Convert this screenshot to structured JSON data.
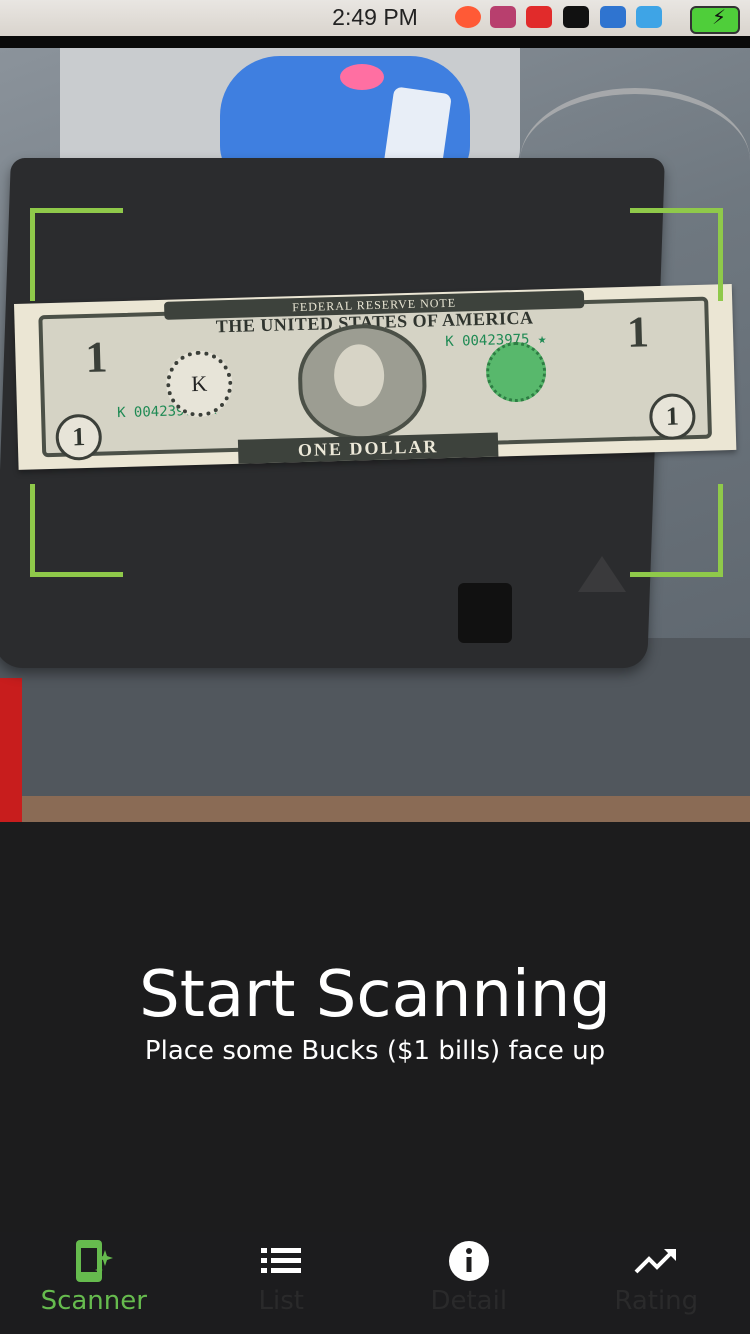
{
  "status_bar": {
    "time": "2:49 PM"
  },
  "scanner": {
    "headline": "Start Scanning",
    "instruction": "Place some Bucks ($1 bills) face up"
  },
  "bill": {
    "top_banner": "FEDERAL RESERVE NOTE",
    "title": "THE UNITED STATES OF AMERICA",
    "serial": "K 00423975 ★",
    "seal_letter": "K",
    "denomination_text": "ONE DOLLAR",
    "corner_value": "1"
  },
  "tabs": [
    {
      "label": "Scanner",
      "icon": "scanner-icon",
      "active": true
    },
    {
      "label": "List",
      "icon": "list-icon",
      "active": false
    },
    {
      "label": "Detail",
      "icon": "info-icon",
      "active": false
    },
    {
      "label": "Rating",
      "icon": "trending-up-icon",
      "active": false
    }
  ],
  "colors": {
    "accent": "#66bb4e",
    "frame": "#8fc94a",
    "background": "#1c1c1d",
    "text": "#ffffff"
  }
}
